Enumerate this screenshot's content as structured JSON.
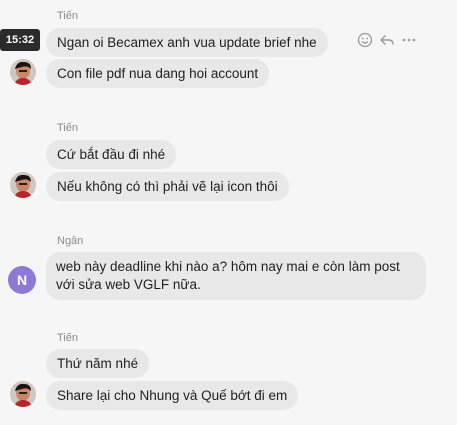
{
  "messages": [
    {
      "sender": "Tiến",
      "lines": [
        "Ngan oi Becamex anh vua update brief nhe",
        "Con file pdf nua dang hoi account"
      ]
    },
    {
      "sender": "Tiến",
      "lines": [
        "Cứ bắt đầu đi nhé",
        "Nếu không có thì phải vẽ lại icon thôi"
      ]
    },
    {
      "sender": "Ngân",
      "avatar_letter": "N",
      "lines": [
        "web này deadline khi nào a? hôm nay mai e còn làm post với sửa web VGLF nữa."
      ]
    },
    {
      "sender": "Tiến",
      "lines": [
        "Thứ năm nhé",
        "Share lại cho Nhung và Quế bớt đi em"
      ]
    }
  ],
  "hover": {
    "timestamp": "15:32",
    "actions": [
      "emoji-react-icon",
      "reply-icon",
      "more-icon"
    ]
  },
  "colors": {
    "bubble": "#e8e8e8",
    "avatar_letter_bg": "#8e79d6",
    "timestamp_bg": "#2b2b2b",
    "background": "#f6f6f6"
  }
}
